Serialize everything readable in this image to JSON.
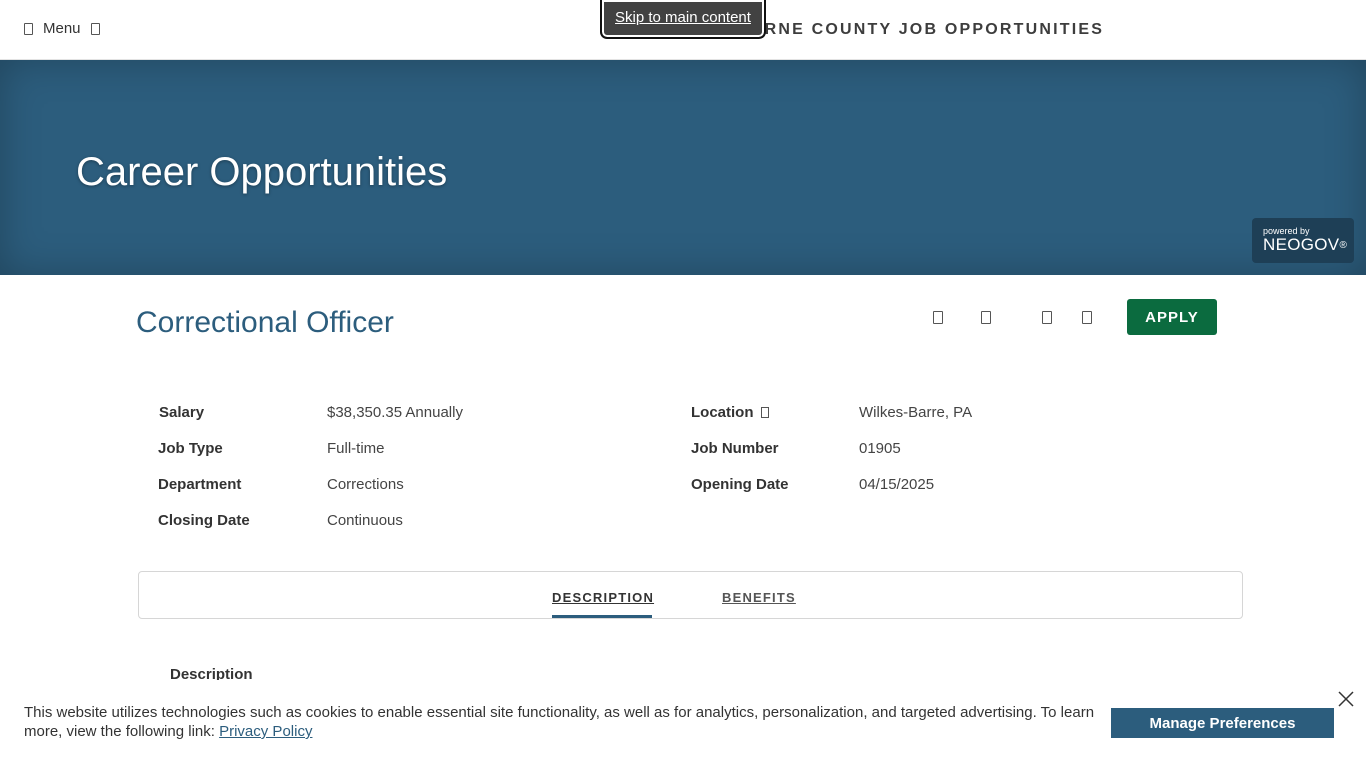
{
  "header": {
    "menu_label": "Menu",
    "site_title": "LUZERNE COUNTY JOB OPPORTUNITIES",
    "skip_link": "Skip to main content"
  },
  "hero": {
    "title": "Career Opportunities",
    "powered_by": "powered by",
    "brand": "NEOGOV",
    "brand_mark": "®"
  },
  "job": {
    "title": "Correctional Officer",
    "apply_label": "APPLY",
    "action_icons": [
      "print-icon",
      "email-icon",
      "share-icon",
      "bookmark-icon"
    ]
  },
  "details": {
    "salary_label": "Salary",
    "salary_value": "$38,350.35 Annually",
    "job_type_label": "Job Type",
    "job_type_value": "Full-time",
    "department_label": "Department",
    "department_value": "Corrections",
    "closing_label": "Closing Date",
    "closing_value": "Continuous",
    "location_label": "Location",
    "location_value": "Wilkes-Barre, PA",
    "job_number_label": "Job Number",
    "job_number_value": "01905",
    "opening_label": "Opening Date",
    "opening_value": "04/15/2025"
  },
  "tabs": [
    {
      "label": "DESCRIPTION",
      "active": true
    },
    {
      "label": "BENEFITS",
      "active": false
    }
  ],
  "content": {
    "section_heading": "Description"
  },
  "cookie": {
    "text": "This website utilizes technologies such as cookies to enable essential site functionality, as well as for analytics, personalization, and targeted advertising. To learn more, view the following link: ",
    "link_text": "Privacy Policy",
    "button_label": "Manage Preferences"
  },
  "colors": {
    "brand_blue": "#2c5d7d",
    "apply_green": "#0b6b3f",
    "neogov_badge": "#1e3f56"
  }
}
